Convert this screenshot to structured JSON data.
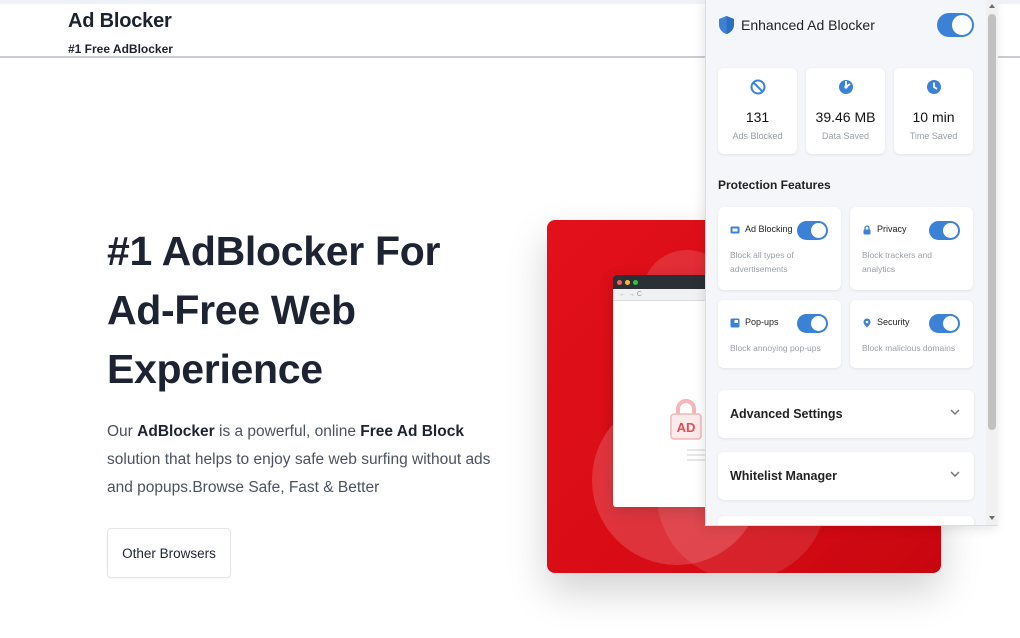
{
  "site": {
    "brand_title": "Ad Blocker",
    "brand_subtitle": "#1 Free AdBlocker",
    "hero_title_lines": [
      "#1 AdBlocker For",
      "Ad-Free Web",
      "Experience"
    ],
    "hero_desc": {
      "p1": "Our ",
      "b1": "AdBlocker",
      "p2": " is a powerful, online ",
      "b2": "Free Ad Block",
      "p3": " solution that helps to enjoy safe web surfing without ads and popups.Browse Safe, Fast & Better"
    },
    "other_browsers_label": "Other Browsers",
    "art": {
      "lock_text": "AD",
      "accent": "#e2101a"
    }
  },
  "popup": {
    "title": "Enhanced Ad Blocker",
    "master_toggle_on": true,
    "icon": "shield-icon",
    "stats": [
      {
        "icon": "block-icon",
        "value": "131",
        "label": "Ads Blocked"
      },
      {
        "icon": "data-icon",
        "value": "39.46 MB",
        "label": "Data Saved"
      },
      {
        "icon": "clock-icon",
        "value": "10 min",
        "label": "Time Saved"
      }
    ],
    "features_title": "Protection Features",
    "features": [
      {
        "icon": "ad-icon",
        "name": "Ad Blocking",
        "desc": "Block all types of advertisements",
        "on": true
      },
      {
        "icon": "lock-icon",
        "name": "Privacy",
        "desc": "Block trackers and analytics",
        "on": true
      },
      {
        "icon": "popup-icon",
        "name": "Pop-ups",
        "desc": "Block annoying pop-ups",
        "on": true
      },
      {
        "icon": "location-icon",
        "name": "Security",
        "desc": "Block malicious domains",
        "on": true
      }
    ],
    "accordions": [
      {
        "label": "Advanced Settings"
      },
      {
        "label": "Whitelist Manager"
      }
    ],
    "colors": {
      "accent": "#3b82d6",
      "bg": "#f5f6f9"
    }
  }
}
